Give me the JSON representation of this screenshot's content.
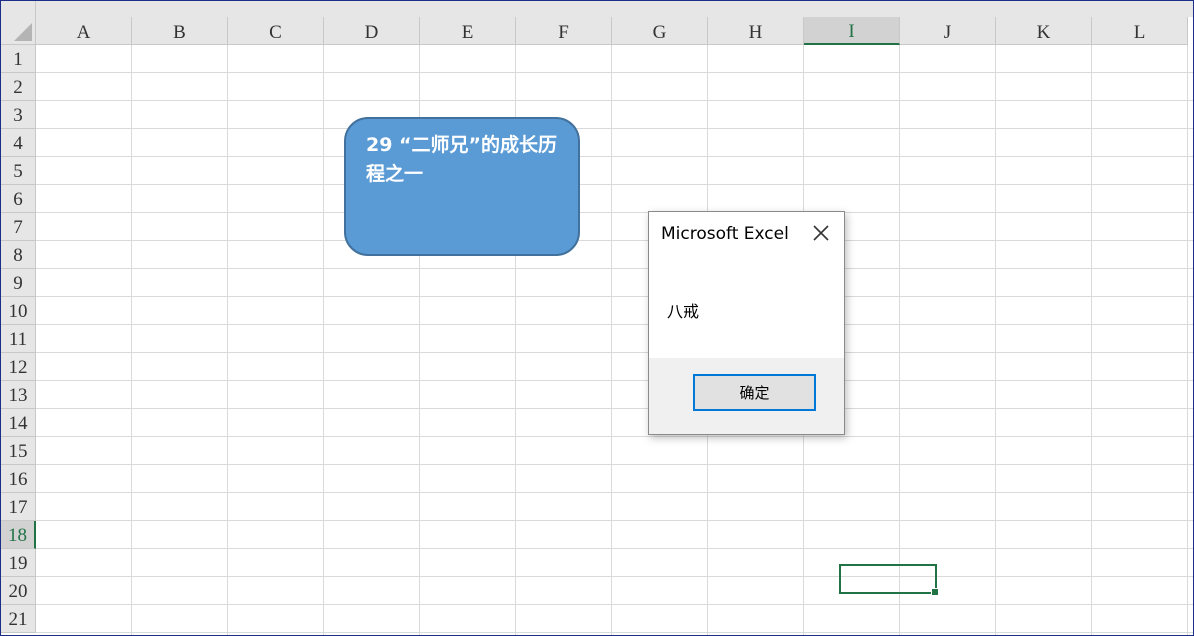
{
  "sheet": {
    "columns": [
      "A",
      "B",
      "C",
      "D",
      "E",
      "F",
      "G",
      "H",
      "I",
      "J",
      "K",
      "L"
    ],
    "rows": [
      "1",
      "2",
      "3",
      "4",
      "5",
      "6",
      "7",
      "8",
      "9",
      "10",
      "11",
      "12",
      "13",
      "14",
      "15",
      "16",
      "17",
      "18",
      "19",
      "20",
      "21"
    ],
    "selected_column": "I",
    "selected_row": "18",
    "active_cell": "I18"
  },
  "shape": {
    "text": "29 “二师兄”的成长历程之一",
    "fill_color": "#5b9bd5"
  },
  "dialog": {
    "title": "Microsoft Excel",
    "message": "八戒",
    "ok_label": "确定",
    "close_icon": "close-icon"
  },
  "colors": {
    "accent": "#217346",
    "button_focus": "#0078d7"
  }
}
